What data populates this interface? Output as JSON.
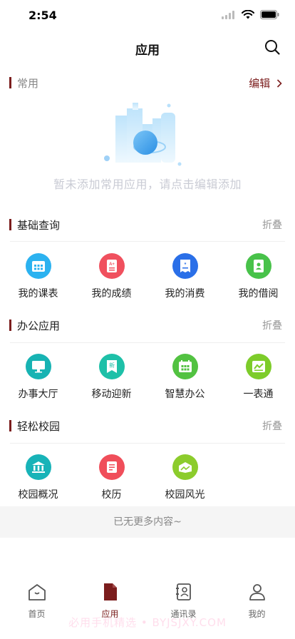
{
  "status": {
    "time": "2:54"
  },
  "nav": {
    "title": "应用"
  },
  "favorites": {
    "title": "常用",
    "edit_label": "编辑",
    "empty_text": "暂未添加常用应用，请点击编辑添加"
  },
  "sections": [
    {
      "title": "基础查询",
      "collapse_label": "折叠",
      "items": [
        {
          "label": "我的课表",
          "icon": "calendar-icon",
          "color": "#2bb2f0"
        },
        {
          "label": "我的成绩",
          "icon": "grade-report-icon",
          "color": "#f0505e"
        },
        {
          "label": "我的消费",
          "icon": "receipt-icon",
          "color": "#2a6fe8"
        },
        {
          "label": "我的借阅",
          "icon": "book-borrow-icon",
          "color": "#48c24a"
        }
      ]
    },
    {
      "title": "办公应用",
      "collapse_label": "折叠",
      "items": [
        {
          "label": "办事大厅",
          "icon": "monitor-icon",
          "color": "#17b3b3"
        },
        {
          "label": "移动迎新",
          "icon": "welcome-newcomer-icon",
          "color": "#1ec0a8"
        },
        {
          "label": "智慧办公",
          "icon": "office-calendar-icon",
          "color": "#52c241"
        },
        {
          "label": "一表通",
          "icon": "form-icon",
          "color": "#7dcc2a"
        }
      ]
    },
    {
      "title": "轻松校园",
      "collapse_label": "折叠",
      "items": [
        {
          "label": "校园概况",
          "icon": "campus-building-icon",
          "color": "#18b3b8"
        },
        {
          "label": "校历",
          "icon": "school-calendar-icon",
          "color": "#f04e5a"
        },
        {
          "label": "校园风光",
          "icon": "scenery-icon",
          "color": "#8ccc2c"
        }
      ]
    }
  ],
  "footer": {
    "no_more": "已无更多内容~"
  },
  "tabs": [
    {
      "label": "首页",
      "icon": "home-icon"
    },
    {
      "label": "应用",
      "icon": "apps-icon",
      "active": true
    },
    {
      "label": "通讯录",
      "icon": "contacts-icon"
    },
    {
      "label": "我的",
      "icon": "profile-icon"
    }
  ],
  "watermark": "必用手机精选 • BYJSJXY.COM",
  "colors": {
    "accent": "#7b1d1d",
    "muted": "#999999",
    "empty_text": "#c9cbd4"
  }
}
